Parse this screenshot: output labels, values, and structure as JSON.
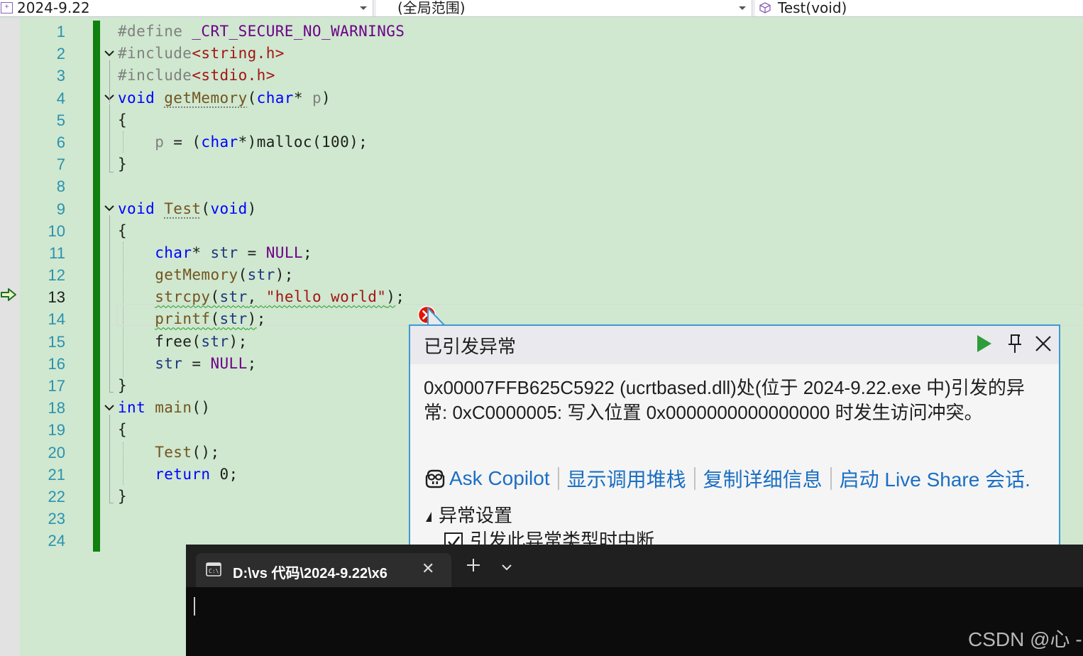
{
  "navbar": {
    "project": "2024-9.22",
    "scope": "(全局范围)",
    "function": "Test(void)"
  },
  "editor": {
    "line_numbers": [
      "1",
      "2",
      "3",
      "4",
      "5",
      "6",
      "7",
      "8",
      "9",
      "10",
      "11",
      "12",
      "13",
      "14",
      "15",
      "16",
      "17",
      "18",
      "19",
      "20",
      "21",
      "22",
      "23",
      "24"
    ],
    "current_line": 13
  },
  "exception": {
    "title": "已引发异常",
    "message": "0x00007FFB625C5922 (ucrtbased.dll)处(位于 2024-9.22.exe 中)引发的异常: 0xC0000005: 写入位置 0x0000000000000000 时发生访问冲突。",
    "links": {
      "ask_copilot": "Ask Copilot",
      "show_call_stack": "显示调用堆栈",
      "copy_details": "复制详细信息",
      "live_share": "启动 Live Share 会话."
    },
    "settings_label": "异常设置",
    "break_checkbox_label": "引发此异常类型时中断",
    "break_checked": true
  },
  "terminal": {
    "tab_title": "D:\\vs 代码\\2024-9.22\\x6",
    "watermark": "CSDN @心 -"
  },
  "colors": {
    "editor_background": "#cfe8cf",
    "keyword": "#0000ff",
    "string": "#a31515",
    "macro": "#6f008a",
    "function": "#74531f",
    "line_number": "#2b91af",
    "change_bar": "#108010",
    "popup_border": "#3c9ad6",
    "link": "#1a6fc3",
    "terminal_bg": "#0c0c0c"
  }
}
